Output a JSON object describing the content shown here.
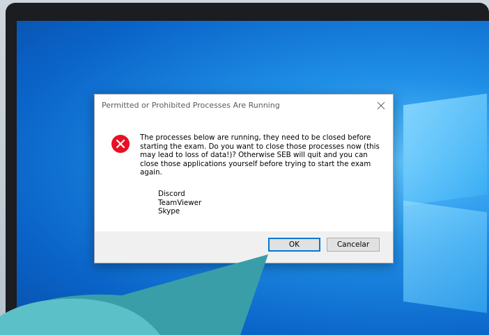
{
  "dialog": {
    "title": "Permitted or Prohibited Processes Are Running",
    "message": "The processes below are running, they need to be closed before starting the exam. Do you want to close those processes now (this may lead to loss of data!)? Otherwise SEB will quit and you can close those applications yourself before trying to start the exam again.",
    "processes": [
      "Discord",
      "TeamViewer",
      "Skype"
    ],
    "ok_label": "OK",
    "cancel_label": "Cancelar",
    "icon": "error-icon",
    "close_icon": "close-icon"
  },
  "colors": {
    "error_red": "#e81123",
    "default_button_border": "#0078d7",
    "wallpaper_blue": "#0a63c8",
    "speech_bubble": "#3a9ea8"
  }
}
